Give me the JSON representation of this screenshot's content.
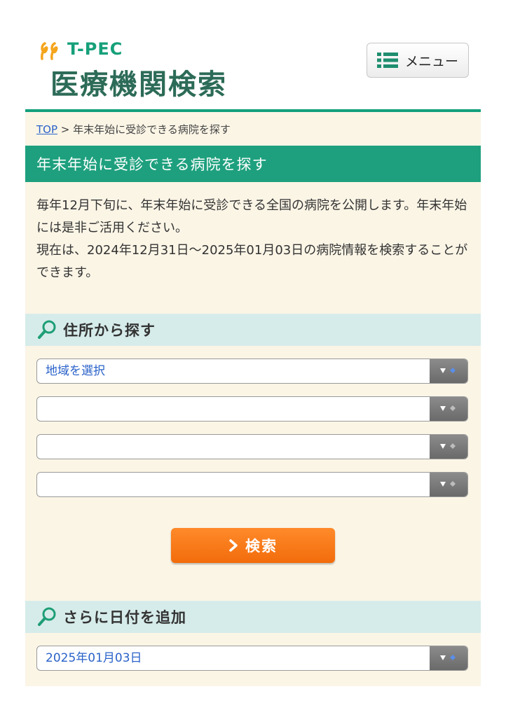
{
  "header": {
    "logo_brand": "T-PEC",
    "logo_title": "医療機関検索",
    "menu_label": "メニュー"
  },
  "breadcrumb": {
    "home": "TOP",
    "separator": ">",
    "current": "年末年始に受診できる病院を探す"
  },
  "page_title": "年末年始に受診できる病院を探す",
  "intro": {
    "paragraph1": "毎年12月下旬に、年末年始に受診できる全国の病院を公開します。年末年始には是非ご活用ください。",
    "paragraph2": "現在は、2024年12月31日〜2025年01月03日の病院情報を検索することができます。"
  },
  "address_search": {
    "heading": "住所から探す",
    "selects": [
      {
        "value": "地域を選択"
      },
      {
        "value": ""
      },
      {
        "value": ""
      },
      {
        "value": ""
      }
    ],
    "search_button": "検索"
  },
  "date_add": {
    "heading": "さらに日付を追加",
    "select_value": "2025年01月03日"
  },
  "colors": {
    "accent_green": "#1ea07e",
    "search_orange": "#f37a18",
    "section_bg": "#d6ecea",
    "content_bg": "#fbf5e6",
    "link_blue": "#2a62c9"
  },
  "icons": {
    "menu": "list-menu-icon",
    "search": "magnifier-icon",
    "logo": "ribbon-logo-icon",
    "select_arrow": "dropdown-arrow-icon",
    "button_chevron": "chevron-right-icon"
  }
}
